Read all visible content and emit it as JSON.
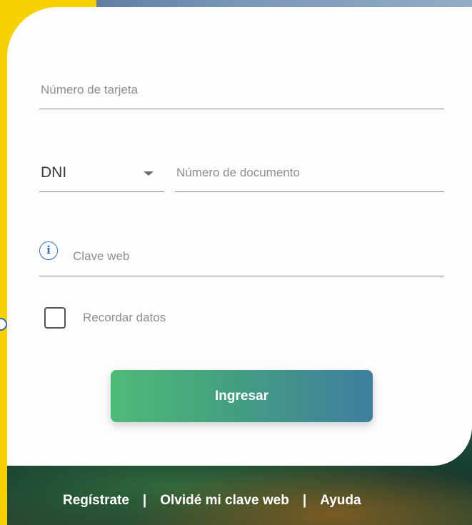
{
  "form": {
    "card_number_placeholder": "Número de tarjeta",
    "doc_type_selected": "DNI",
    "doc_number_placeholder": "Número de documento",
    "password_placeholder": "Clave web",
    "info_icon_glyph": "i",
    "remember_label": "Recordar datos",
    "remember_checked": false,
    "submit_label": "Ingresar"
  },
  "footer": {
    "register": "Regístrate",
    "forgot": "Olvidé mi clave web",
    "help": "Ayuda",
    "separator": "|"
  },
  "colors": {
    "brand_yellow": "#f7d200",
    "button_start": "#4fba78",
    "button_end": "#3f7ea0",
    "info_blue": "#2f6fc0"
  }
}
